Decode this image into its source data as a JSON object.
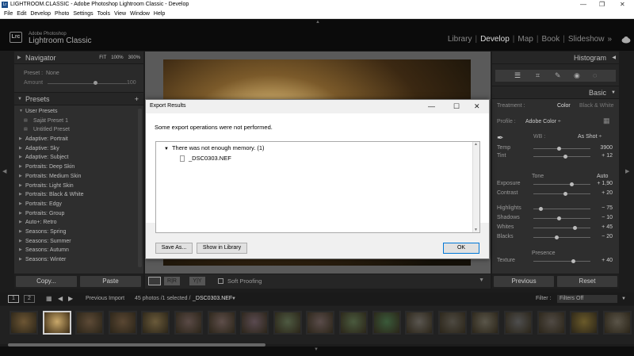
{
  "os_title": "LIGHTROOM.CLASSIC - Adobe Photoshop Lightroom Classic - Develop",
  "os_logo": "Lr",
  "menu": [
    "File",
    "Edit",
    "Develop",
    "Photo",
    "Settings",
    "Tools",
    "View",
    "Window",
    "Help"
  ],
  "brand": {
    "line1": "Adobe Photoshop",
    "line2": "Lightroom Classic",
    "logo": "Lrc"
  },
  "modules": [
    "Library",
    "Develop",
    "Map",
    "Book",
    "Slideshow"
  ],
  "modules_more": "»",
  "active_module": "Develop",
  "navigator": {
    "title": "Navigator",
    "opts": [
      "FIT",
      "100%",
      "300%"
    ]
  },
  "preset_line": {
    "label": "Preset :",
    "value": "None"
  },
  "amount": {
    "label": "Amount",
    "value": "100"
  },
  "presets": {
    "title": "Presets",
    "add": "+",
    "items": [
      {
        "label": "User Presets",
        "level": 0,
        "open": true
      },
      {
        "label": "Sajàt Preset 1",
        "level": 1
      },
      {
        "label": "Untitled Preset",
        "level": 1
      },
      {
        "label": "Adaptive: Portrait",
        "level": 0
      },
      {
        "label": "Adaptive: Sky",
        "level": 0
      },
      {
        "label": "Adaptive: Subject",
        "level": 0
      },
      {
        "label": "Portraits: Deep Skin",
        "level": 0
      },
      {
        "label": "Portraits: Medium Skin",
        "level": 0
      },
      {
        "label": "Portraits: Light Skin",
        "level": 0
      },
      {
        "label": "Portraits: Black & White",
        "level": 0
      },
      {
        "label": "Portraits: Edgy",
        "level": 0
      },
      {
        "label": "Portraits: Group",
        "level": 0
      },
      {
        "label": "Auto+: Retro",
        "level": 0
      },
      {
        "label": "Seasons: Spring",
        "level": 0
      },
      {
        "label": "Seasons: Summer",
        "level": 0
      },
      {
        "label": "Seasons: Autumn",
        "level": 0
      },
      {
        "label": "Seasons: Winter",
        "level": 0
      }
    ]
  },
  "left_buttons": {
    "copy": "Copy...",
    "paste": "Paste"
  },
  "histogram": {
    "title": "Histogram"
  },
  "basic": {
    "title": "Basic",
    "treatment_label": "Treatment :",
    "treatment_color": "Color",
    "treatment_bw": "Black & White",
    "profile_label": "Profile :",
    "profile_value": "Adobe Color ÷",
    "wb_label": "WB :",
    "wb_value": "As Shot ÷",
    "tone_label": "Tone",
    "auto_label": "Auto",
    "presence_label": "Presence",
    "sliders": [
      {
        "label": "Temp",
        "value": "3900",
        "pos": 0.45
      },
      {
        "label": "Tint",
        "value": "+ 12",
        "pos": 0.55
      },
      {
        "label": "Exposure",
        "value": "+ 1,90",
        "pos": 0.66
      },
      {
        "label": "Contrast",
        "value": "+ 20",
        "pos": 0.55
      },
      {
        "label": "Highlights",
        "value": "− 75",
        "pos": 0.13
      },
      {
        "label": "Shadows",
        "value": "− 10",
        "pos": 0.45
      },
      {
        "label": "Whites",
        "value": "+ 45",
        "pos": 0.72
      },
      {
        "label": "Blacks",
        "value": "− 20",
        "pos": 0.4
      },
      {
        "label": "Texture",
        "value": "+ 40",
        "pos": 0.7
      }
    ]
  },
  "right_buttons": {
    "previous": "Previous",
    "reset": "Reset"
  },
  "center_tool": {
    "soft_proofing": "Soft Proofing"
  },
  "dialog": {
    "title": "Export Results",
    "message": "Some export operations were not performed.",
    "tree_parent": "There was not enough memory. (1)",
    "tree_child": "_DSC0303.NEF",
    "save_as": "Save As...",
    "show_in_library": "Show in Library",
    "ok": "OK"
  },
  "filmstrip_bar": {
    "screen1": "1",
    "screen2": "2",
    "source": "Previous Import",
    "count": "45 photos /1 selected /",
    "file": "_DSC0303.NEF",
    "filter_label": "Filter :",
    "filter_value": "Filters Off"
  },
  "thumb_colors": [
    "#6d5634",
    "#8a6a3a",
    "#5d4a36",
    "#5a4733",
    "#6a5a3a",
    "#5a4a46",
    "#5e4e4a",
    "#5a4a50",
    "#4e5a42",
    "#5a4c4a",
    "#4a5a3e",
    "#3a5a3a",
    "#5a5650",
    "#4e4a42",
    "#5a564a",
    "#4e4e4e",
    "#504a44",
    "#6a5a2a",
    "#5a5448",
    "#6a5a20"
  ],
  "colors": {
    "accent_yellow": "#e8c26a",
    "panel": "#2e2e2e"
  }
}
